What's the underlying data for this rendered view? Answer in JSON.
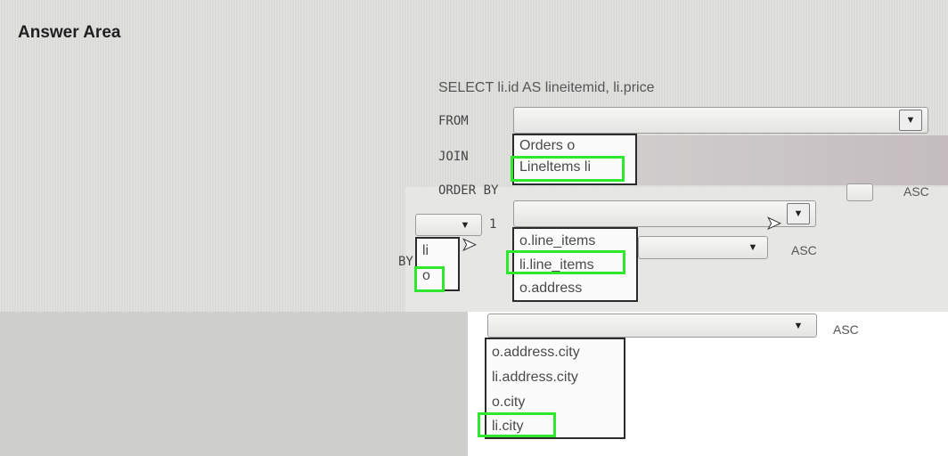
{
  "title": "Answer Area",
  "select_line": "SELECT li.id AS lineitemid, li.price",
  "keywords": {
    "from": "FROM",
    "join": "JOIN",
    "order_by": "ORDER BY",
    "one": "1",
    "by": "BY"
  },
  "asc": "ASC",
  "from_options": [
    "Orders o",
    "Lineltems li"
  ],
  "alias_options": [
    "li",
    "o"
  ],
  "join_options": [
    "o.line_items",
    "li.line_items",
    "o.address"
  ],
  "order_options": [
    "o.address.city",
    "li.address.city",
    "o.city",
    "li.city"
  ],
  "icons": {
    "dropdown": "chevron-down-icon",
    "pointer": "mouse-pointer-icon"
  },
  "colors": {
    "highlight": "#2ee82e",
    "list_border": "#2b2b2b"
  }
}
